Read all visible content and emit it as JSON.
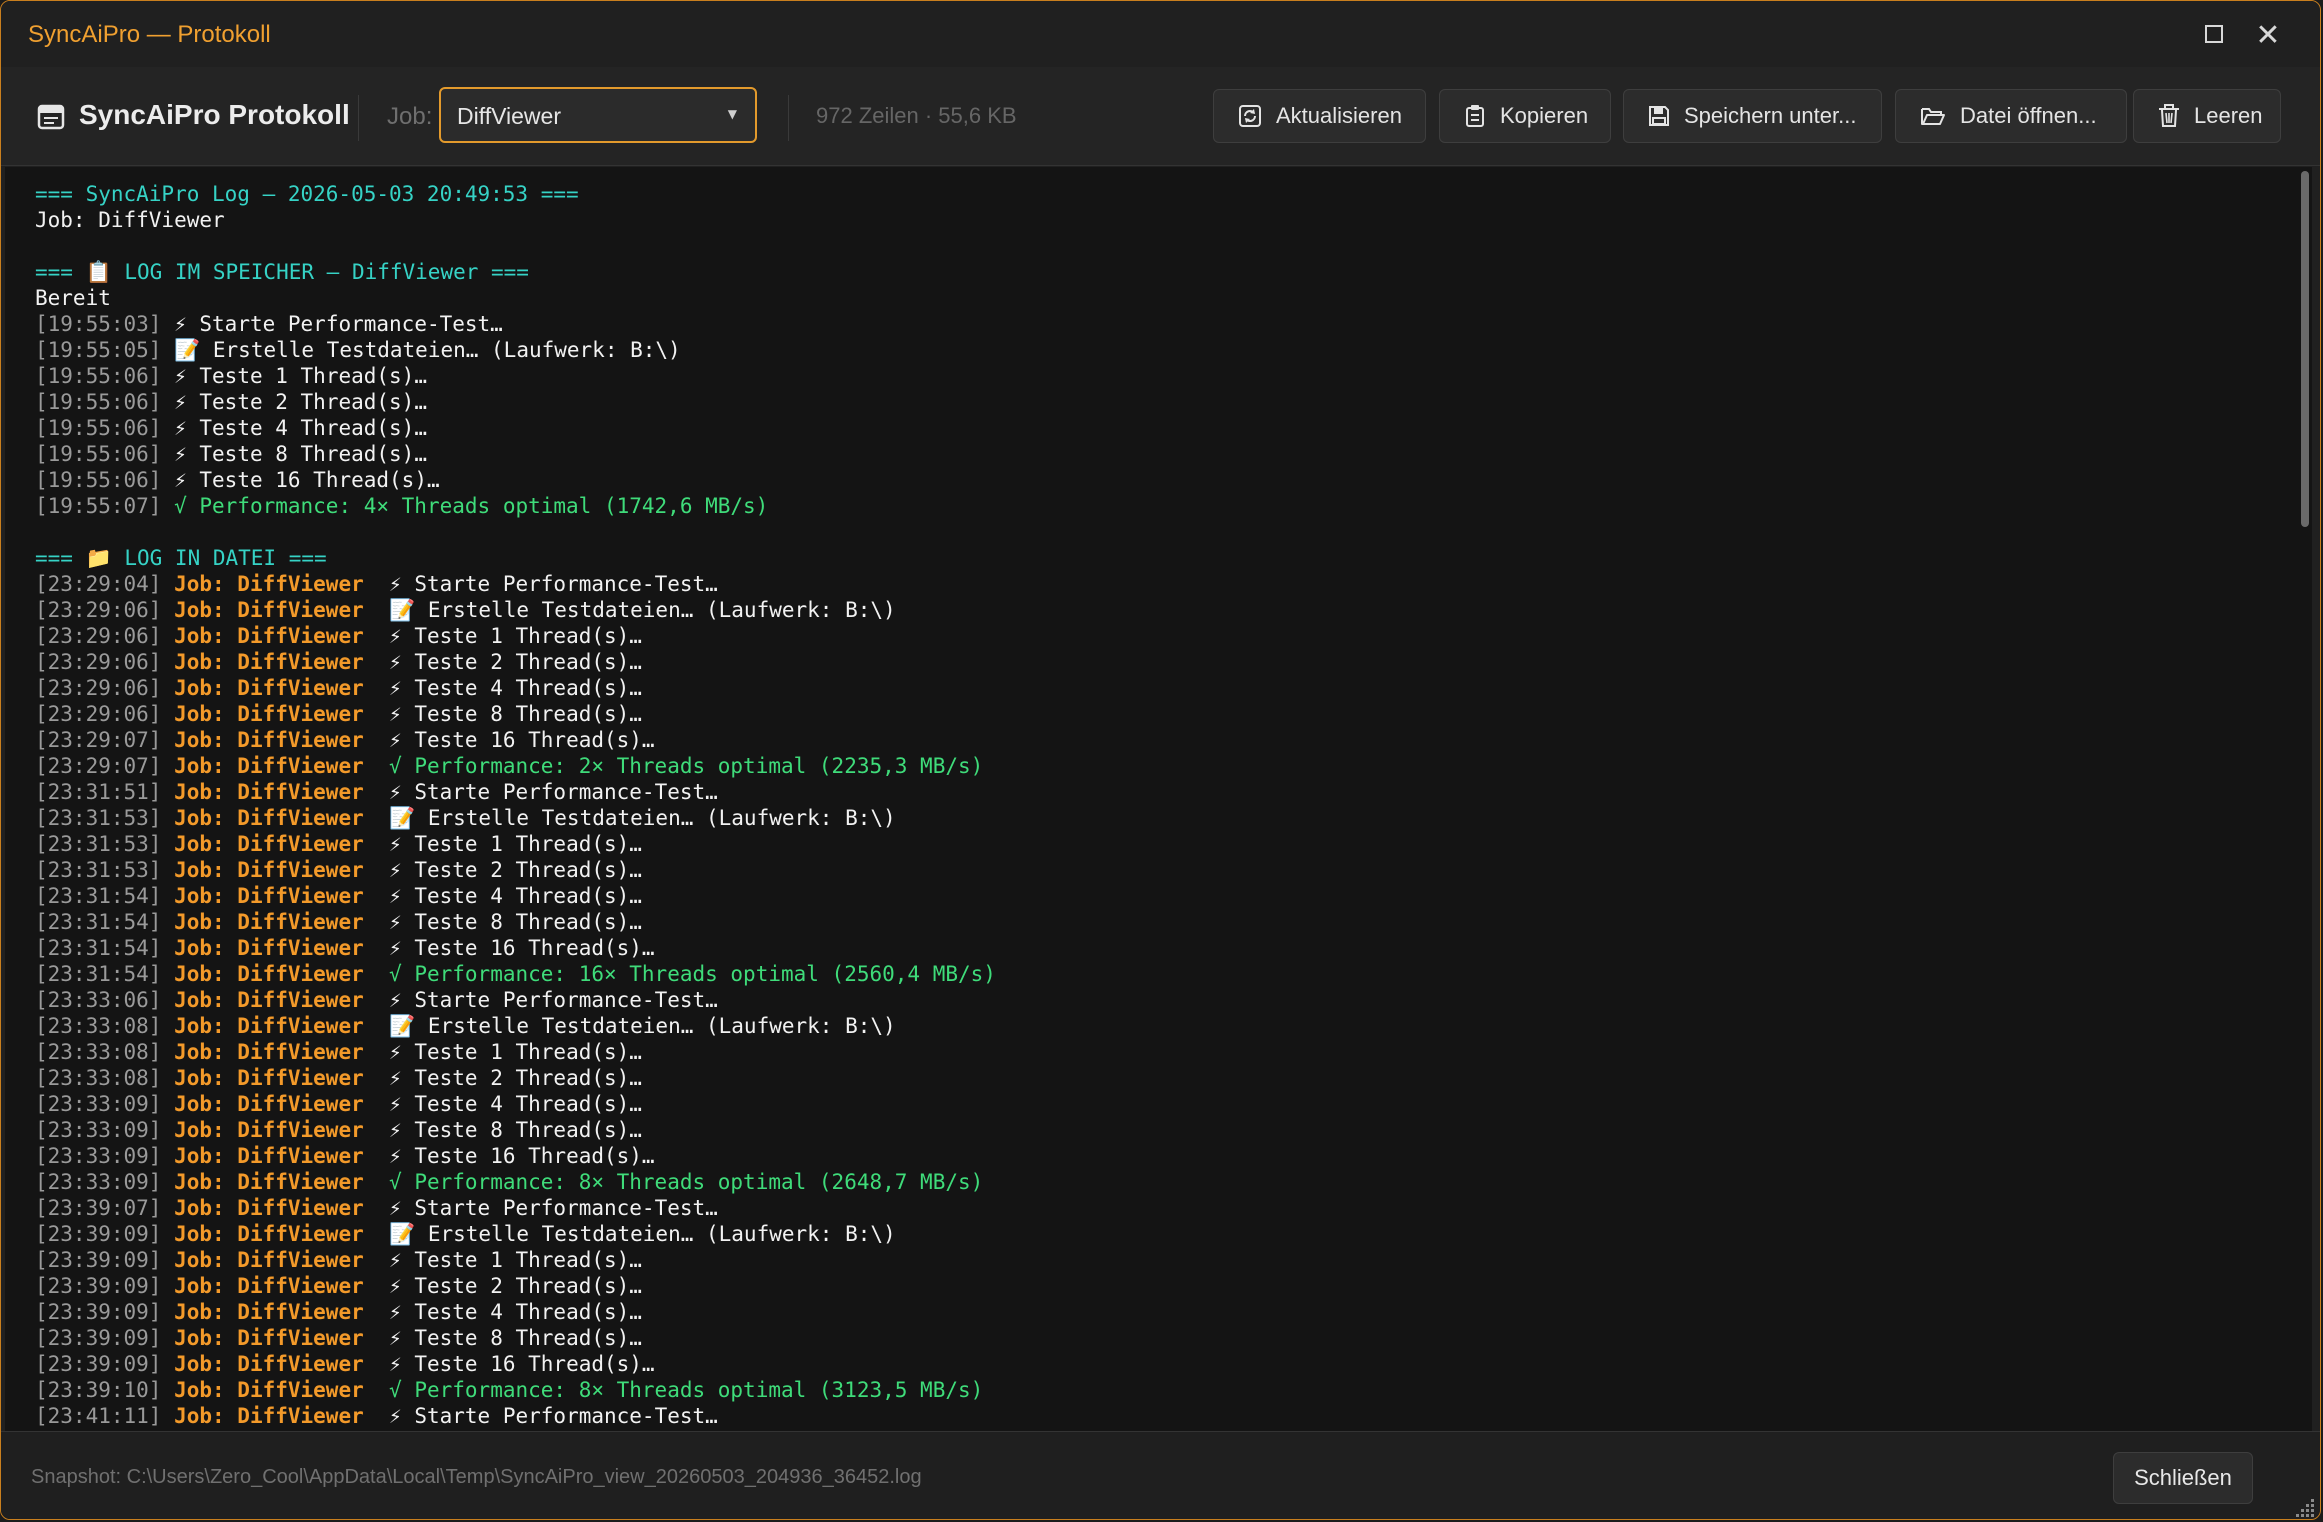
{
  "window": {
    "title": "SyncAiPro — Protokoll"
  },
  "toolbar": {
    "app_title": "SyncAiPro Protokoll",
    "job_label": "Job:",
    "job_value": "DiffViewer",
    "stats": "972 Zeilen · 55,6 KB",
    "buttons": {
      "refresh": "Aktualisieren",
      "copy": "Kopieren",
      "save_as": "Speichern unter...",
      "open_file": "Datei öffnen...",
      "clear": "Leeren"
    }
  },
  "log": {
    "lines": [
      {
        "kind": "header",
        "text": "=== SyncAiPro Log – 2026-05-03 20:49:53 ==="
      },
      {
        "kind": "plain",
        "text": "Job: DiffViewer"
      },
      {
        "kind": "blank",
        "text": ""
      },
      {
        "kind": "header",
        "text": "=== 📋 LOG IM SPEICHER – DiffViewer ==="
      },
      {
        "kind": "plain",
        "text": "Bereit"
      },
      {
        "kind": "mem",
        "ts": "[19:55:03]",
        "icon": "⚡",
        "msg": " Starte Performance-Test…"
      },
      {
        "kind": "mem",
        "ts": "[19:55:05]",
        "icon": "📝",
        "msg": " Erstelle Testdateien… (Laufwerk: B:\\)"
      },
      {
        "kind": "mem",
        "ts": "[19:55:06]",
        "icon": "⚡",
        "msg": " Teste 1 Thread(s)…"
      },
      {
        "kind": "mem",
        "ts": "[19:55:06]",
        "icon": "⚡",
        "msg": " Teste 2 Thread(s)…"
      },
      {
        "kind": "mem",
        "ts": "[19:55:06]",
        "icon": "⚡",
        "msg": " Teste 4 Thread(s)…"
      },
      {
        "kind": "mem",
        "ts": "[19:55:06]",
        "icon": "⚡",
        "msg": " Teste 8 Thread(s)…"
      },
      {
        "kind": "mem",
        "ts": "[19:55:06]",
        "icon": "⚡",
        "msg": " Teste 16 Thread(s)…"
      },
      {
        "kind": "memok",
        "ts": "[19:55:07]",
        "msg": "√ Performance: 4× Threads optimal (1742,6 MB/s)"
      },
      {
        "kind": "blank",
        "text": ""
      },
      {
        "kind": "header",
        "text": "=== 📁 LOG IN DATEI ==="
      },
      {
        "kind": "file",
        "ts": "[23:29:04]",
        "job": "Job: DiffViewer",
        "icon": "⚡",
        "msg": " Starte Performance-Test…"
      },
      {
        "kind": "file",
        "ts": "[23:29:06]",
        "job": "Job: DiffViewer",
        "icon": "📝",
        "msg": " Erstelle Testdateien… (Laufwerk: B:\\)"
      },
      {
        "kind": "file",
        "ts": "[23:29:06]",
        "job": "Job: DiffViewer",
        "icon": "⚡",
        "msg": " Teste 1 Thread(s)…"
      },
      {
        "kind": "file",
        "ts": "[23:29:06]",
        "job": "Job: DiffViewer",
        "icon": "⚡",
        "msg": " Teste 2 Thread(s)…"
      },
      {
        "kind": "file",
        "ts": "[23:29:06]",
        "job": "Job: DiffViewer",
        "icon": "⚡",
        "msg": " Teste 4 Thread(s)…"
      },
      {
        "kind": "file",
        "ts": "[23:29:06]",
        "job": "Job: DiffViewer",
        "icon": "⚡",
        "msg": " Teste 8 Thread(s)…"
      },
      {
        "kind": "file",
        "ts": "[23:29:07]",
        "job": "Job: DiffViewer",
        "icon": "⚡",
        "msg": " Teste 16 Thread(s)…"
      },
      {
        "kind": "fileok",
        "ts": "[23:29:07]",
        "job": "Job: DiffViewer",
        "msg": "√ Performance: 2× Threads optimal (2235,3 MB/s)"
      },
      {
        "kind": "file",
        "ts": "[23:31:51]",
        "job": "Job: DiffViewer",
        "icon": "⚡",
        "msg": " Starte Performance-Test…"
      },
      {
        "kind": "file",
        "ts": "[23:31:53]",
        "job": "Job: DiffViewer",
        "icon": "📝",
        "msg": " Erstelle Testdateien… (Laufwerk: B:\\)"
      },
      {
        "kind": "file",
        "ts": "[23:31:53]",
        "job": "Job: DiffViewer",
        "icon": "⚡",
        "msg": " Teste 1 Thread(s)…"
      },
      {
        "kind": "file",
        "ts": "[23:31:53]",
        "job": "Job: DiffViewer",
        "icon": "⚡",
        "msg": " Teste 2 Thread(s)…"
      },
      {
        "kind": "file",
        "ts": "[23:31:54]",
        "job": "Job: DiffViewer",
        "icon": "⚡",
        "msg": " Teste 4 Thread(s)…"
      },
      {
        "kind": "file",
        "ts": "[23:31:54]",
        "job": "Job: DiffViewer",
        "icon": "⚡",
        "msg": " Teste 8 Thread(s)…"
      },
      {
        "kind": "file",
        "ts": "[23:31:54]",
        "job": "Job: DiffViewer",
        "icon": "⚡",
        "msg": " Teste 16 Thread(s)…"
      },
      {
        "kind": "fileok",
        "ts": "[23:31:54]",
        "job": "Job: DiffViewer",
        "msg": "√ Performance: 16× Threads optimal (2560,4 MB/s)"
      },
      {
        "kind": "file",
        "ts": "[23:33:06]",
        "job": "Job: DiffViewer",
        "icon": "⚡",
        "msg": " Starte Performance-Test…"
      },
      {
        "kind": "file",
        "ts": "[23:33:08]",
        "job": "Job: DiffViewer",
        "icon": "📝",
        "msg": " Erstelle Testdateien… (Laufwerk: B:\\)"
      },
      {
        "kind": "file",
        "ts": "[23:33:08]",
        "job": "Job: DiffViewer",
        "icon": "⚡",
        "msg": " Teste 1 Thread(s)…"
      },
      {
        "kind": "file",
        "ts": "[23:33:08]",
        "job": "Job: DiffViewer",
        "icon": "⚡",
        "msg": " Teste 2 Thread(s)…"
      },
      {
        "kind": "file",
        "ts": "[23:33:09]",
        "job": "Job: DiffViewer",
        "icon": "⚡",
        "msg": " Teste 4 Thread(s)…"
      },
      {
        "kind": "file",
        "ts": "[23:33:09]",
        "job": "Job: DiffViewer",
        "icon": "⚡",
        "msg": " Teste 8 Thread(s)…"
      },
      {
        "kind": "file",
        "ts": "[23:33:09]",
        "job": "Job: DiffViewer",
        "icon": "⚡",
        "msg": " Teste 16 Thread(s)…"
      },
      {
        "kind": "fileok",
        "ts": "[23:33:09]",
        "job": "Job: DiffViewer",
        "msg": "√ Performance: 8× Threads optimal (2648,7 MB/s)"
      },
      {
        "kind": "file",
        "ts": "[23:39:07]",
        "job": "Job: DiffViewer",
        "icon": "⚡",
        "msg": " Starte Performance-Test…"
      },
      {
        "kind": "file",
        "ts": "[23:39:09]",
        "job": "Job: DiffViewer",
        "icon": "📝",
        "msg": " Erstelle Testdateien… (Laufwerk: B:\\)"
      },
      {
        "kind": "file",
        "ts": "[23:39:09]",
        "job": "Job: DiffViewer",
        "icon": "⚡",
        "msg": " Teste 1 Thread(s)…"
      },
      {
        "kind": "file",
        "ts": "[23:39:09]",
        "job": "Job: DiffViewer",
        "icon": "⚡",
        "msg": " Teste 2 Thread(s)…"
      },
      {
        "kind": "file",
        "ts": "[23:39:09]",
        "job": "Job: DiffViewer",
        "icon": "⚡",
        "msg": " Teste 4 Thread(s)…"
      },
      {
        "kind": "file",
        "ts": "[23:39:09]",
        "job": "Job: DiffViewer",
        "icon": "⚡",
        "msg": " Teste 8 Thread(s)…"
      },
      {
        "kind": "file",
        "ts": "[23:39:09]",
        "job": "Job: DiffViewer",
        "icon": "⚡",
        "msg": " Teste 16 Thread(s)…"
      },
      {
        "kind": "fileok",
        "ts": "[23:39:10]",
        "job": "Job: DiffViewer",
        "msg": "√ Performance: 8× Threads optimal (3123,5 MB/s)"
      },
      {
        "kind": "file",
        "ts": "[23:41:11]",
        "job": "Job: DiffViewer",
        "icon": "⚡",
        "msg": " Starte Performance-Test…"
      }
    ]
  },
  "footer": {
    "snapshot": "Snapshot: C:\\Users\\Zero_Cool\\AppData\\Local\\Temp\\SyncAiPro_view_20260503_204936_36452.log",
    "close_label": "Schließen"
  },
  "colors": {
    "accent": "#f39a2a",
    "header": "#36d3c6",
    "success": "#3fdc7a",
    "timestamp": "#9a9a9a"
  }
}
